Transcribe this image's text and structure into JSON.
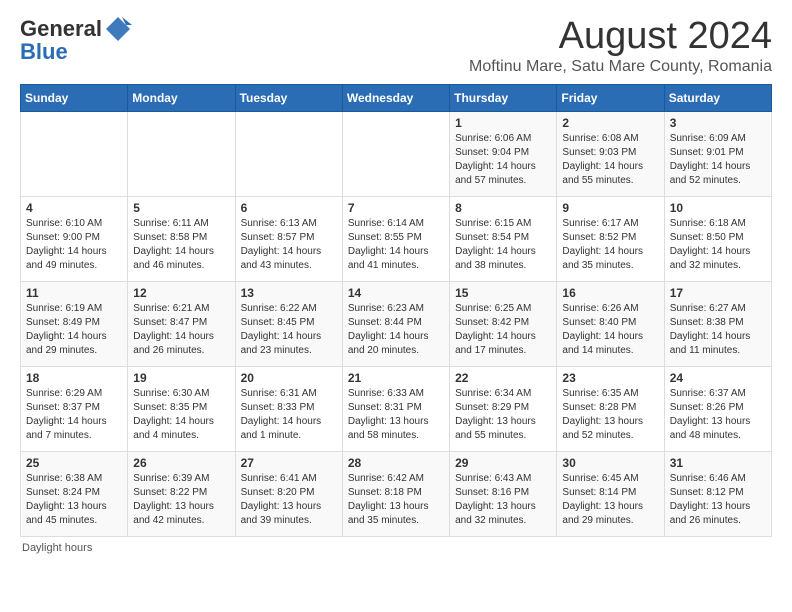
{
  "header": {
    "logo_general": "General",
    "logo_blue": "Blue",
    "main_title": "August 2024",
    "subtitle": "Moftinu Mare, Satu Mare County, Romania"
  },
  "calendar": {
    "days_of_week": [
      "Sunday",
      "Monday",
      "Tuesday",
      "Wednesday",
      "Thursday",
      "Friday",
      "Saturday"
    ],
    "weeks": [
      [
        {
          "day": "",
          "info": ""
        },
        {
          "day": "",
          "info": ""
        },
        {
          "day": "",
          "info": ""
        },
        {
          "day": "",
          "info": ""
        },
        {
          "day": "1",
          "info": "Sunrise: 6:06 AM\nSunset: 9:04 PM\nDaylight: 14 hours\nand 57 minutes."
        },
        {
          "day": "2",
          "info": "Sunrise: 6:08 AM\nSunset: 9:03 PM\nDaylight: 14 hours\nand 55 minutes."
        },
        {
          "day": "3",
          "info": "Sunrise: 6:09 AM\nSunset: 9:01 PM\nDaylight: 14 hours\nand 52 minutes."
        }
      ],
      [
        {
          "day": "4",
          "info": "Sunrise: 6:10 AM\nSunset: 9:00 PM\nDaylight: 14 hours\nand 49 minutes."
        },
        {
          "day": "5",
          "info": "Sunrise: 6:11 AM\nSunset: 8:58 PM\nDaylight: 14 hours\nand 46 minutes."
        },
        {
          "day": "6",
          "info": "Sunrise: 6:13 AM\nSunset: 8:57 PM\nDaylight: 14 hours\nand 43 minutes."
        },
        {
          "day": "7",
          "info": "Sunrise: 6:14 AM\nSunset: 8:55 PM\nDaylight: 14 hours\nand 41 minutes."
        },
        {
          "day": "8",
          "info": "Sunrise: 6:15 AM\nSunset: 8:54 PM\nDaylight: 14 hours\nand 38 minutes."
        },
        {
          "day": "9",
          "info": "Sunrise: 6:17 AM\nSunset: 8:52 PM\nDaylight: 14 hours\nand 35 minutes."
        },
        {
          "day": "10",
          "info": "Sunrise: 6:18 AM\nSunset: 8:50 PM\nDaylight: 14 hours\nand 32 minutes."
        }
      ],
      [
        {
          "day": "11",
          "info": "Sunrise: 6:19 AM\nSunset: 8:49 PM\nDaylight: 14 hours\nand 29 minutes."
        },
        {
          "day": "12",
          "info": "Sunrise: 6:21 AM\nSunset: 8:47 PM\nDaylight: 14 hours\nand 26 minutes."
        },
        {
          "day": "13",
          "info": "Sunrise: 6:22 AM\nSunset: 8:45 PM\nDaylight: 14 hours\nand 23 minutes."
        },
        {
          "day": "14",
          "info": "Sunrise: 6:23 AM\nSunset: 8:44 PM\nDaylight: 14 hours\nand 20 minutes."
        },
        {
          "day": "15",
          "info": "Sunrise: 6:25 AM\nSunset: 8:42 PM\nDaylight: 14 hours\nand 17 minutes."
        },
        {
          "day": "16",
          "info": "Sunrise: 6:26 AM\nSunset: 8:40 PM\nDaylight: 14 hours\nand 14 minutes."
        },
        {
          "day": "17",
          "info": "Sunrise: 6:27 AM\nSunset: 8:38 PM\nDaylight: 14 hours\nand 11 minutes."
        }
      ],
      [
        {
          "day": "18",
          "info": "Sunrise: 6:29 AM\nSunset: 8:37 PM\nDaylight: 14 hours\nand 7 minutes."
        },
        {
          "day": "19",
          "info": "Sunrise: 6:30 AM\nSunset: 8:35 PM\nDaylight: 14 hours\nand 4 minutes."
        },
        {
          "day": "20",
          "info": "Sunrise: 6:31 AM\nSunset: 8:33 PM\nDaylight: 14 hours\nand 1 minute."
        },
        {
          "day": "21",
          "info": "Sunrise: 6:33 AM\nSunset: 8:31 PM\nDaylight: 13 hours\nand 58 minutes."
        },
        {
          "day": "22",
          "info": "Sunrise: 6:34 AM\nSunset: 8:29 PM\nDaylight: 13 hours\nand 55 minutes."
        },
        {
          "day": "23",
          "info": "Sunrise: 6:35 AM\nSunset: 8:28 PM\nDaylight: 13 hours\nand 52 minutes."
        },
        {
          "day": "24",
          "info": "Sunrise: 6:37 AM\nSunset: 8:26 PM\nDaylight: 13 hours\nand 48 minutes."
        }
      ],
      [
        {
          "day": "25",
          "info": "Sunrise: 6:38 AM\nSunset: 8:24 PM\nDaylight: 13 hours\nand 45 minutes."
        },
        {
          "day": "26",
          "info": "Sunrise: 6:39 AM\nSunset: 8:22 PM\nDaylight: 13 hours\nand 42 minutes."
        },
        {
          "day": "27",
          "info": "Sunrise: 6:41 AM\nSunset: 8:20 PM\nDaylight: 13 hours\nand 39 minutes."
        },
        {
          "day": "28",
          "info": "Sunrise: 6:42 AM\nSunset: 8:18 PM\nDaylight: 13 hours\nand 35 minutes."
        },
        {
          "day": "29",
          "info": "Sunrise: 6:43 AM\nSunset: 8:16 PM\nDaylight: 13 hours\nand 32 minutes."
        },
        {
          "day": "30",
          "info": "Sunrise: 6:45 AM\nSunset: 8:14 PM\nDaylight: 13 hours\nand 29 minutes."
        },
        {
          "day": "31",
          "info": "Sunrise: 6:46 AM\nSunset: 8:12 PM\nDaylight: 13 hours\nand 26 minutes."
        }
      ]
    ]
  },
  "footer": {
    "text": "Daylight hours"
  }
}
